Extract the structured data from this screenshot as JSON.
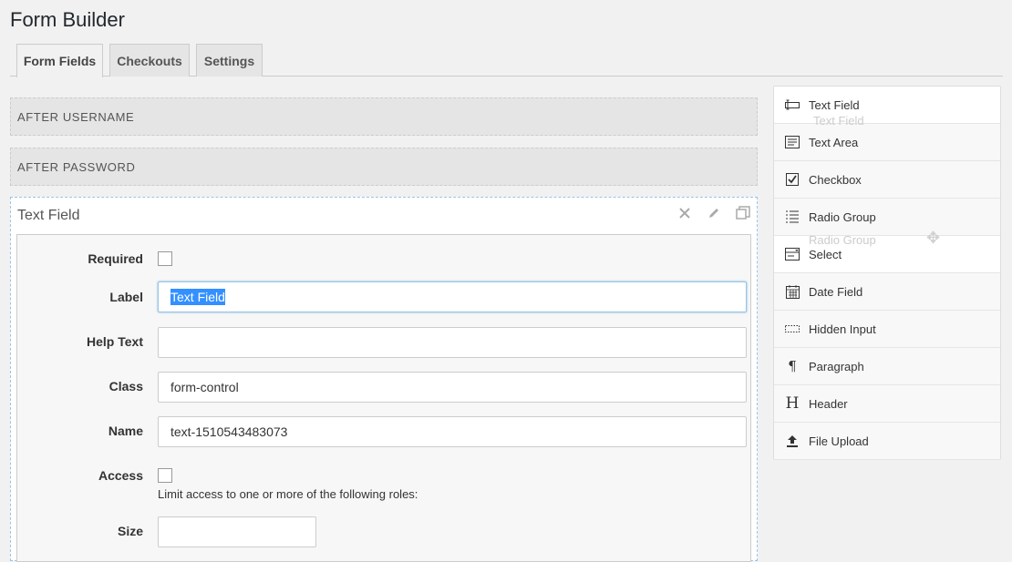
{
  "page": {
    "title": "Form Builder"
  },
  "tabs": [
    {
      "label": "Form Fields",
      "active": true
    },
    {
      "label": "Checkouts",
      "active": false
    },
    {
      "label": "Settings",
      "active": false
    }
  ],
  "drop_zones": [
    "AFTER USERNAME",
    "AFTER PASSWORD"
  ],
  "field_card": {
    "title": "Text Field",
    "fields": {
      "required_label": "Required",
      "label_label": "Label",
      "label_value": "Text Field",
      "help_label": "Help Text",
      "help_value": "",
      "class_label": "Class",
      "class_value": "form-control",
      "name_label": "Name",
      "name_value": "text-1510543483073",
      "access_label": "Access",
      "access_hint": "Limit access to one or more of the following roles:",
      "size_label": "Size",
      "size_value": ""
    }
  },
  "palette": [
    {
      "label": "Text Field",
      "icon": "text-field-icon"
    },
    {
      "label": "Text Area",
      "icon": "text-area-icon"
    },
    {
      "label": "Checkbox",
      "icon": "checkbox-icon"
    },
    {
      "label": "Radio Group",
      "icon": "radio-group-icon"
    },
    {
      "label": "Select",
      "icon": "select-icon"
    },
    {
      "label": "Date Field",
      "icon": "calendar-icon"
    },
    {
      "label": "Hidden Input",
      "icon": "hidden-input-icon"
    },
    {
      "label": "Paragraph",
      "icon": "paragraph-icon"
    },
    {
      "label": "Header",
      "icon": "header-icon"
    },
    {
      "label": "File Upload",
      "icon": "upload-icon"
    }
  ],
  "drag_ghosts": [
    "Text Field",
    "Radio Group"
  ]
}
